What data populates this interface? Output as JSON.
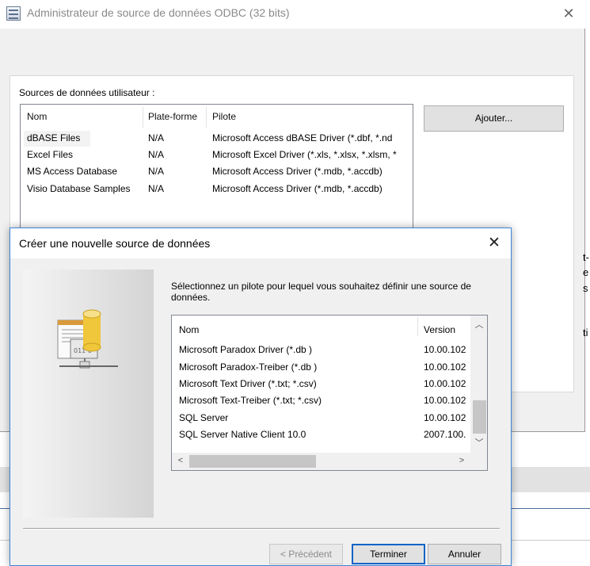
{
  "odbc_window": {
    "title": "Administrateur de source de données ODBC (32 bits)",
    "close_icon": "close-icon",
    "sources_label": "Sources de données utilisateur :",
    "columns": [
      "Nom",
      "Plate-forme",
      "Pilote"
    ],
    "rows": [
      {
        "name": "dBASE Files",
        "platform": "N/A",
        "driver": "Microsoft Access dBASE Driver (*.dbf, *.nd"
      },
      {
        "name": "Excel Files",
        "platform": "N/A",
        "driver": "Microsoft Excel Driver (*.xls, *.xlsx, *.xlsm, *"
      },
      {
        "name": "MS Access Database",
        "platform": "N/A",
        "driver": "Microsoft Access Driver (*.mdb, *.accdb)"
      },
      {
        "name": "Visio Database Samples",
        "platform": "N/A",
        "driver": "Microsoft Access Driver (*.mdb, *.accdb)"
      }
    ],
    "add_button": "Ajouter...",
    "cut_off_text": [
      "t-",
      "e",
      "s",
      "ti"
    ]
  },
  "dialog": {
    "title": "Créer une nouvelle source de données",
    "instruction": "Sélectionnez un pilote pour lequel vous souhaitez définir une source de données.",
    "columns": [
      "Nom",
      "Version"
    ],
    "drivers": [
      {
        "name": "Microsoft Paradox Driver (*.db )",
        "version": "10.00.102"
      },
      {
        "name": "Microsoft Paradox-Treiber (*.db )",
        "version": "10.00.102"
      },
      {
        "name": "Microsoft Text Driver (*.txt; *.csv)",
        "version": "10.00.102"
      },
      {
        "name": "Microsoft Text-Treiber (*.txt; *.csv)",
        "version": "10.00.102"
      },
      {
        "name": "SQL Server",
        "version": "10.00.102"
      },
      {
        "name": "SQL Server Native Client 10.0",
        "version": "2007.100."
      }
    ],
    "buttons": {
      "previous": "< Précédent",
      "finish": "Terminer",
      "cancel": "Annuler"
    },
    "colors": {
      "accent": "#0a64c8",
      "border": "#3d84d6"
    }
  }
}
